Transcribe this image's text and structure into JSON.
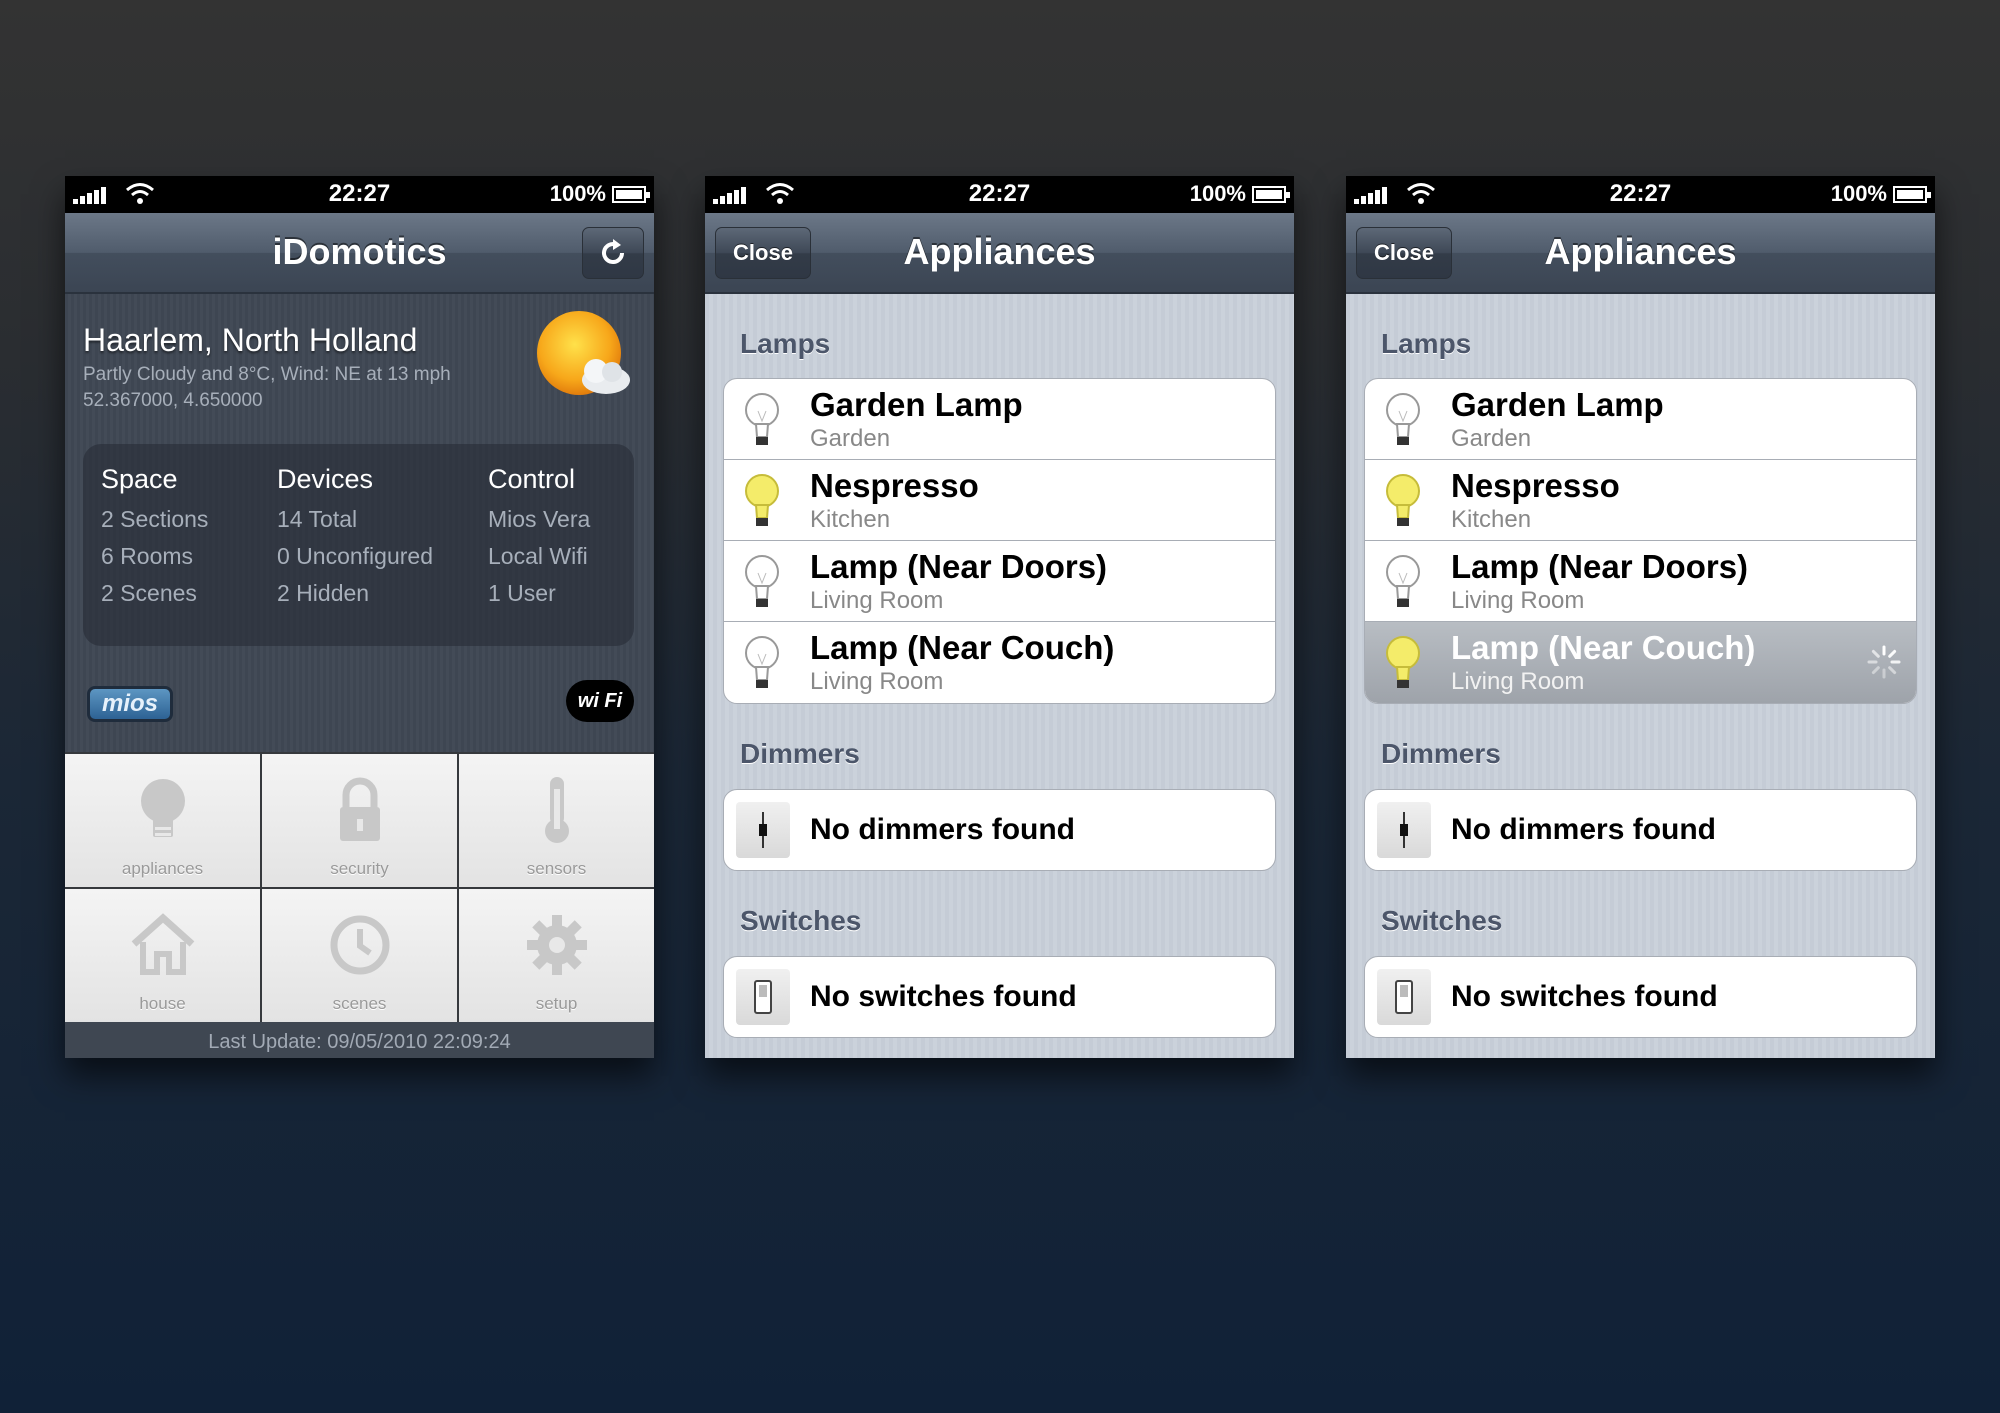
{
  "status_bar": {
    "time": "22:27",
    "battery": "100%"
  },
  "home": {
    "title": "iDomotics",
    "location": "Haarlem, North Holland",
    "weather": "Partly Cloudy and 8°C, Wind: NE at 13 mph",
    "coordinates": "52.367000, 4.650000",
    "stats": {
      "space": {
        "heading": "Space",
        "lines": [
          "2 Sections",
          "6 Rooms",
          "2 Scenes"
        ]
      },
      "devices": {
        "heading": "Devices",
        "lines": [
          "14 Total",
          "0 Unconfigured",
          "2 Hidden"
        ]
      },
      "control": {
        "heading": "Control",
        "lines": [
          "Mios Vera",
          "Local Wifi",
          "1 User"
        ]
      }
    },
    "logos": {
      "mios": "mios",
      "wifi": "wi Fi"
    },
    "tiles": [
      {
        "label": "appliances",
        "icon": "lightbulb-icon"
      },
      {
        "label": "security",
        "icon": "lock-icon"
      },
      {
        "label": "sensors",
        "icon": "thermometer-icon"
      },
      {
        "label": "house",
        "icon": "house-icon"
      },
      {
        "label": "scenes",
        "icon": "clock-icon"
      },
      {
        "label": "setup",
        "icon": "gear-icon"
      }
    ],
    "last_update": "Last Update: 09/05/2010 22:09:24"
  },
  "appliances": {
    "title": "Appliances",
    "close_label": "Close",
    "lamps_title": "Lamps",
    "lamps": [
      {
        "name": "Garden Lamp",
        "room": "Garden",
        "on": false
      },
      {
        "name": "Nespresso",
        "room": "Kitchen",
        "on": true
      },
      {
        "name": "Lamp (Near Doors)",
        "room": "Living Room",
        "on": false
      },
      {
        "name": "Lamp (Near Couch)",
        "room": "Living Room",
        "on": false
      }
    ],
    "dimmers_title": "Dimmers",
    "no_dimmers": "No dimmers found",
    "switches_title": "Switches",
    "no_switches": "No switches found"
  },
  "appliances_loading": {
    "lamps": [
      {
        "name": "Garden Lamp",
        "room": "Garden",
        "on": false
      },
      {
        "name": "Nespresso",
        "room": "Kitchen",
        "on": true
      },
      {
        "name": "Lamp (Near Doors)",
        "room": "Living Room",
        "on": false
      },
      {
        "name": "Lamp (Near Couch)",
        "room": "Living Room",
        "on": true,
        "loading": true
      }
    ]
  },
  "colors": {
    "bulb_on": "#f4ec6a",
    "bulb_off": "#ffffff",
    "nav": "#4a5564"
  }
}
